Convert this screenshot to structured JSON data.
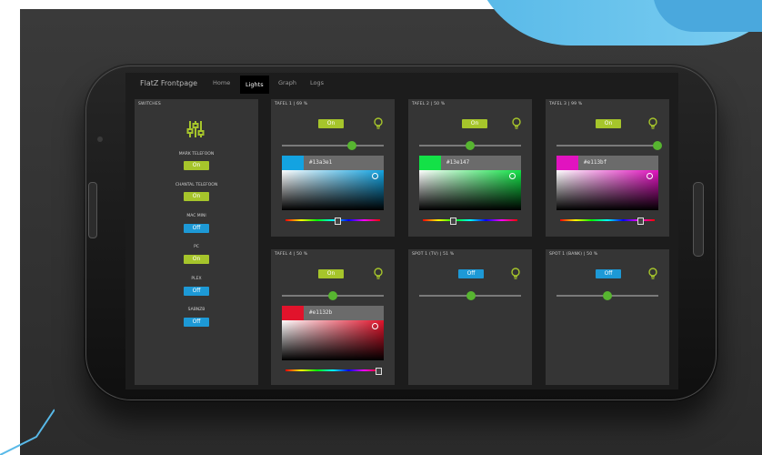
{
  "app": {
    "brand": "FlatZ Frontpage",
    "nav": [
      "Home",
      "Lights",
      "Graph",
      "Logs"
    ],
    "active_nav": "Lights"
  },
  "switches": {
    "title": "SWITCHES",
    "items": [
      {
        "label": "MARK TELEFOON",
        "state": "On"
      },
      {
        "label": "CHANTAL TELEFOON",
        "state": "On"
      },
      {
        "label": "MAC MINI",
        "state": "Off"
      },
      {
        "label": "PC",
        "state": "On"
      },
      {
        "label": "PLEX",
        "state": "Off"
      },
      {
        "label": "SABNZB",
        "state": "Off"
      }
    ]
  },
  "lights": [
    {
      "title": "TAFEL 1 | 69 %",
      "state": "On",
      "level": 0.69,
      "hex": "#13a3e1",
      "swatch": "#13a3e1",
      "hue_pos": 0.55
    },
    {
      "title": "TAFEL 2 | 50 %",
      "state": "On",
      "level": 0.5,
      "hex": "#13e147",
      "swatch": "#13e147",
      "hue_pos": 0.32
    },
    {
      "title": "TAFEL 3 | 99 %",
      "state": "On",
      "level": 0.99,
      "hex": "#e113bf",
      "swatch": "#e113bf",
      "hue_pos": 0.85
    },
    {
      "title": "TAFEL 4 | 50 %",
      "state": "On",
      "level": 0.5,
      "hex": "#e1132b",
      "swatch": "#e1132b",
      "hue_pos": 0.98
    },
    {
      "title": "SPOT 1 (TV) | 51 %",
      "state": "Off",
      "level": 0.51
    },
    {
      "title": "SPOT 1 (BANK) | 50 %",
      "state": "Off",
      "level": 0.5
    }
  ],
  "colors": {
    "on": "#a6c52b",
    "off": "#1d99d6",
    "knob": "#57b530",
    "bulb": "#a6c52b"
  },
  "icons": {
    "switches": "mixer-sliders-icon",
    "bulb": "lightbulb-icon"
  }
}
